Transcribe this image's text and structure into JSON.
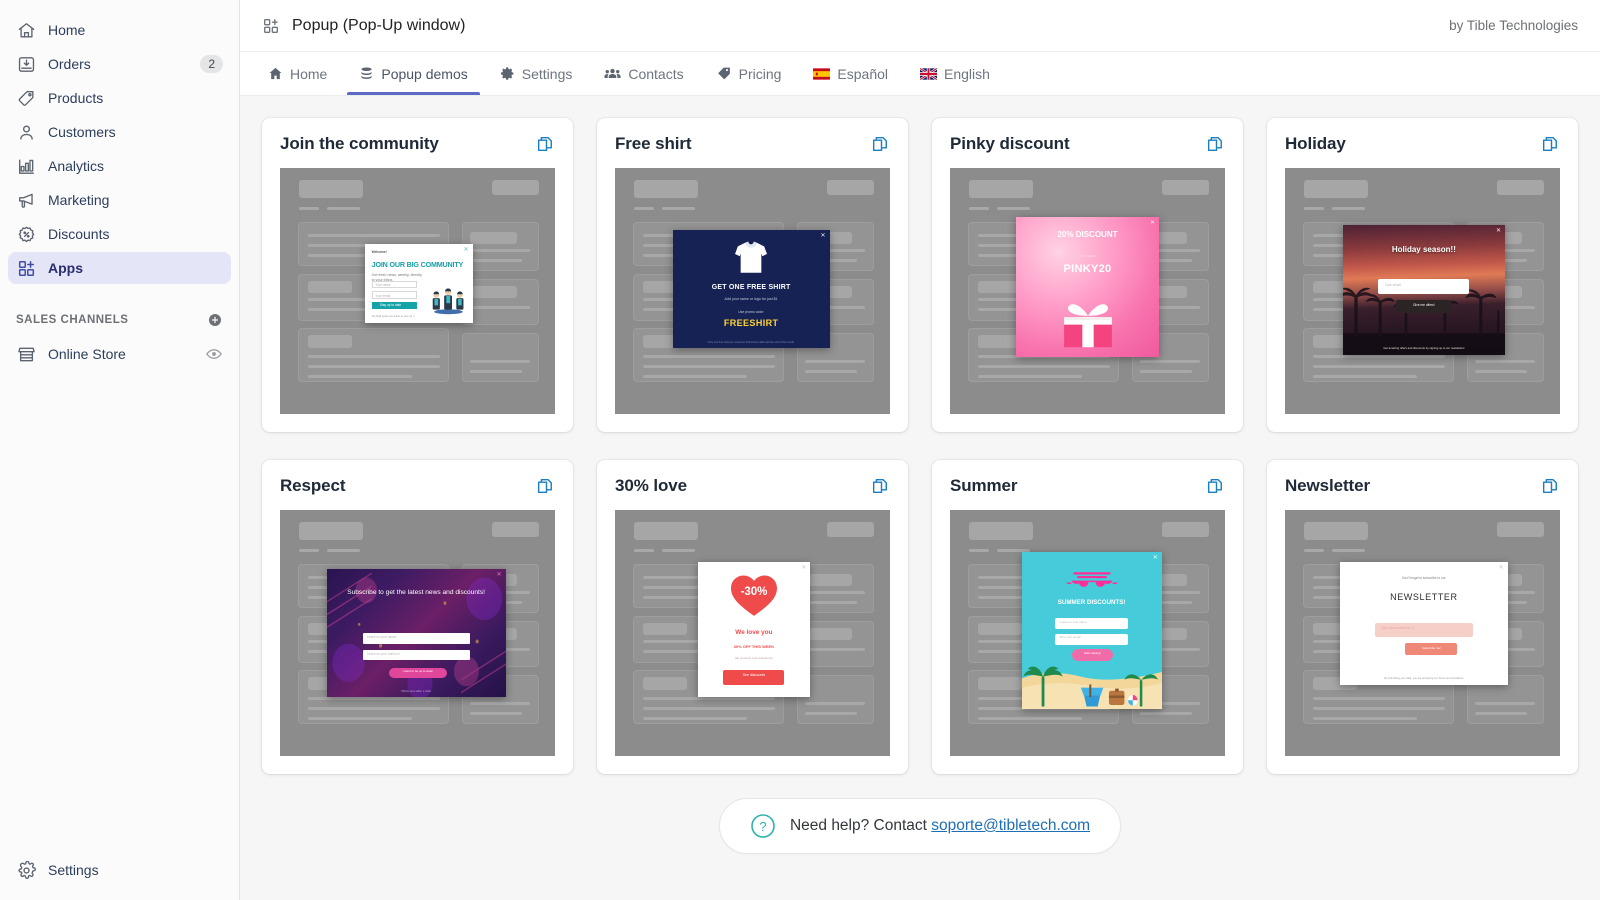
{
  "sidebar": {
    "items": [
      {
        "label": "Home",
        "icon": "home-icon",
        "badge": ""
      },
      {
        "label": "Orders",
        "icon": "orders-icon",
        "badge": "2"
      },
      {
        "label": "Products",
        "icon": "products-tag-icon",
        "badge": ""
      },
      {
        "label": "Customers",
        "icon": "customers-icon",
        "badge": ""
      },
      {
        "label": "Analytics",
        "icon": "analytics-bars-icon",
        "badge": ""
      },
      {
        "label": "Marketing",
        "icon": "marketing-megaphone-icon",
        "badge": ""
      },
      {
        "label": "Discounts",
        "icon": "discounts-badge-icon",
        "badge": ""
      },
      {
        "label": "Apps",
        "icon": "apps-grid-plus-icon",
        "badge": ""
      }
    ],
    "active_item": "Apps",
    "sales_channels": {
      "title": "SALES CHANNELS",
      "add_icon": "plus-circle-icon",
      "items": [
        {
          "label": "Online Store",
          "icon": "storefront-icon",
          "trailing_icon": "eye-icon"
        }
      ]
    },
    "footer": {
      "label": "Settings",
      "icon": "gear-icon"
    }
  },
  "header": {
    "app_icon": "apps-grid-plus-icon",
    "title": "Popup (Pop-Up window)",
    "vendor": "by Tible Technologies"
  },
  "tabs": [
    {
      "label": "Home",
      "icon": "home-icon",
      "active": false
    },
    {
      "label": "Popup demos",
      "icon": "layers-icon",
      "active": true
    },
    {
      "label": "Settings",
      "icon": "gear-icon",
      "active": false
    },
    {
      "label": "Contacts",
      "icon": "people-icon",
      "active": false
    },
    {
      "label": "Pricing",
      "icon": "price-tag-icon",
      "active": false
    },
    {
      "label": "Español",
      "icon": "flag-spain-icon",
      "active": false
    },
    {
      "label": "English",
      "icon": "flag-uk-icon",
      "active": false
    }
  ],
  "cards": [
    {
      "title": "Join the community",
      "copy_icon": "duplicate-icon",
      "popup": {
        "style": "p1",
        "welcome": "Welcome!",
        "heading": "JOIN OUR BIG COMMUNITY",
        "subtext": "Get fresh news, weekly, directly to your inbox.",
        "input_name": "Your name",
        "input_email": "Your email",
        "button": "Stay up to date",
        "note": "No bulk spam we track to you ok :)",
        "close": "✕"
      }
    },
    {
      "title": "Free shirt",
      "copy_icon": "duplicate-icon",
      "popup": {
        "style": "p2",
        "heading": "GET ONE FREE SHIRT",
        "subtext": "Add your name or logo for just $1",
        "use_label": "Use promo code:",
        "code": "FREESHIRT",
        "fine": "Only one free shirt per customer. Promotion valid until the end of the month.",
        "close": "✕"
      }
    },
    {
      "title": "Pinky discount",
      "copy_icon": "duplicate-icon",
      "popup": {
        "style": "p3",
        "heading": "20% DISCOUNT",
        "use_label": "Use coupon:",
        "code": "PINKY20",
        "close": "✕"
      }
    },
    {
      "title": "Holiday",
      "copy_icon": "duplicate-icon",
      "popup": {
        "style": "p4",
        "heading": "Holiday season!!",
        "input_email": "Your email",
        "button": "Give me offers!",
        "fine": "Get amazing offers and discounts by signing up to our newsletter!",
        "close": "✕"
      }
    },
    {
      "title": "Respect",
      "copy_icon": "duplicate-icon",
      "popup": {
        "style": "p5",
        "heading": "Subscribe to get the latest news and discounts!",
        "input_name": "Leave us your name!",
        "input_email": "Leave us your mail too!",
        "button": "I want to be up to date!",
        "fine": "Will be sent within a while",
        "close": "✕"
      }
    },
    {
      "title": "30% love",
      "copy_icon": "duplicate-icon",
      "popup": {
        "style": "p6",
        "badge": "-30%",
        "heading": "We love you",
        "subtext": "30% OFF THIS WEEK",
        "subtext2": "(all products and collections)",
        "button": "See discounts",
        "close": "✕"
      }
    },
    {
      "title": "Summer",
      "copy_icon": "duplicate-icon",
      "popup": {
        "style": "p7",
        "heading": "SUMMER DISCOUNTS!",
        "input_name": "Leave us your name",
        "input_email": "Also your email!",
        "button": "Start saving!",
        "close": "✕"
      }
    },
    {
      "title": "Newsletter",
      "copy_icon": "duplicate-icon",
      "popup": {
        "style": "p8",
        "tiny": "Don't forget to subscribe to our",
        "heading": "NEWSLETTER",
        "input_email": "Type your email here ;)",
        "button": "Subscribe me!",
        "fine": "By submitting your data, you are accepting our Terms and Conditions",
        "close": "✕"
      }
    }
  ],
  "help": {
    "icon": "question-circle-icon",
    "text": "Need help? Contact",
    "link": "soporte@tibletech.com"
  },
  "colors": {
    "accent": "#5c6ac4",
    "sidebar_active_bg": "#e4e5f7",
    "copy_icon": "#1a7fc1",
    "link": "#1f6fb5",
    "help_icon": "#2bb3ab"
  }
}
